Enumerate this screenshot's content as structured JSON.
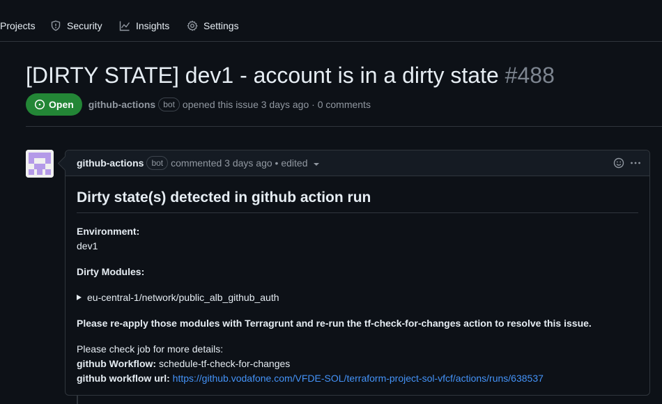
{
  "nav": {
    "items": [
      {
        "label": "Projects",
        "icon": "table-icon"
      },
      {
        "label": "Security",
        "icon": "shield-icon"
      },
      {
        "label": "Insights",
        "icon": "graph-icon"
      },
      {
        "label": "Settings",
        "icon": "gear-icon"
      }
    ]
  },
  "issue": {
    "title": "[DIRTY STATE] dev1 - account is in a dirty state",
    "number": "#488",
    "state": "Open",
    "author": "github-actions",
    "bot_label": "bot",
    "meta_text": "opened this issue 3 days ago · 0 comments"
  },
  "comment": {
    "author": "github-actions",
    "bot_label": "bot",
    "meta_text": "commented 3 days ago • edited",
    "heading": "Dirty state(s) detected in github action run",
    "environment_label": "Environment:",
    "environment_value": "dev1",
    "dirty_modules_label": "Dirty Modules:",
    "module": "eu-central-1/network/public_alb_github_auth",
    "instruction": "Please re-apply those modules with Terragrunt and re-run the tf-check-for-changes action to resolve this issue.",
    "details_text": "Please check job for more details:",
    "workflow_label": "github Workflow:",
    "workflow_value": "schedule-tf-check-for-changes",
    "workflow_url_label": "github workflow url:",
    "workflow_url": "https://github.vodafone.com/VFDE-SOL/terraform-project-sol-vfcf/actions/runs/638537"
  },
  "colors": {
    "background": "#0d1117",
    "open_badge": "#238636",
    "link": "#4493f8",
    "avatar_purple": "#b49ae8"
  }
}
